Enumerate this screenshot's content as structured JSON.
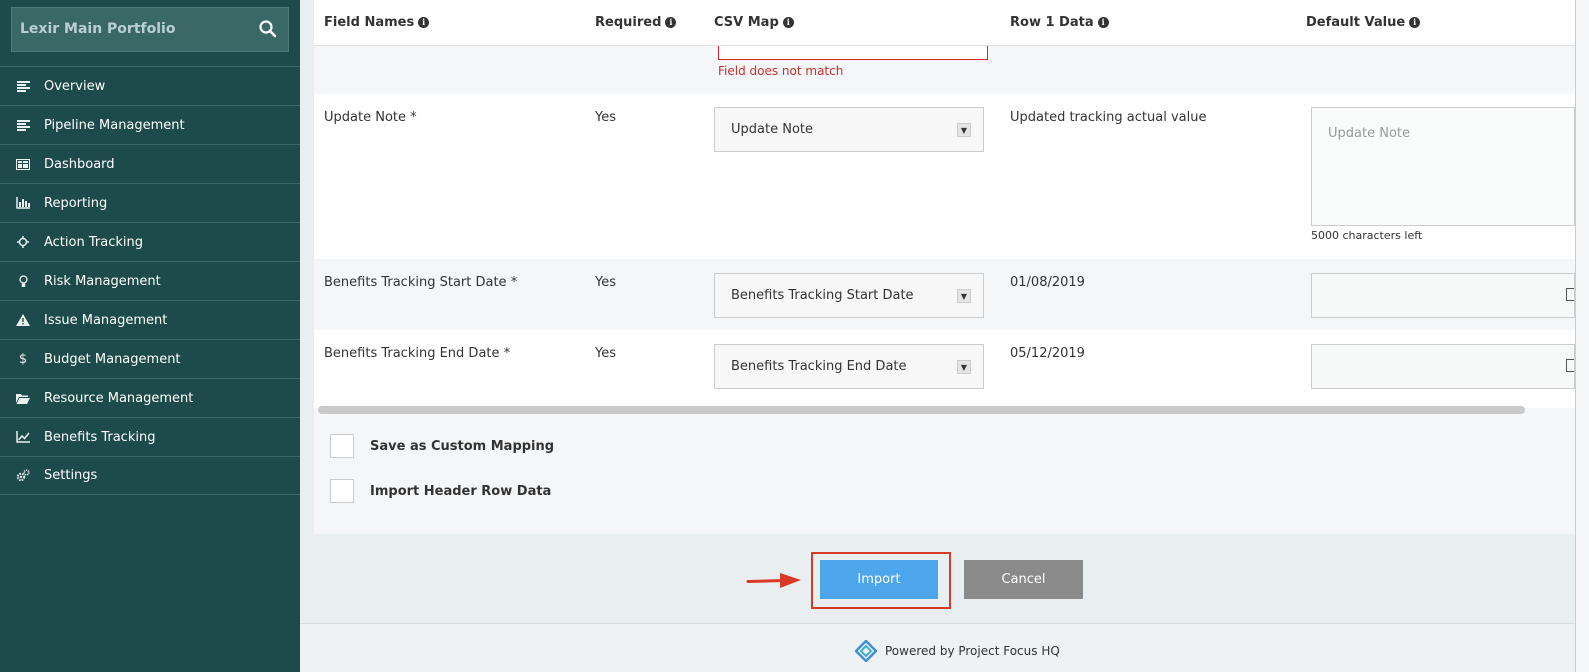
{
  "sidebar": {
    "portfolio_name": "Lexir Main Portfolio",
    "items": [
      {
        "label": "Overview",
        "icon": "list-icon"
      },
      {
        "label": "Pipeline Management",
        "icon": "list-icon"
      },
      {
        "label": "Dashboard",
        "icon": "dashboard-icon"
      },
      {
        "label": "Reporting",
        "icon": "bar-chart-icon"
      },
      {
        "label": "Action Tracking",
        "icon": "crosshair-icon"
      },
      {
        "label": "Risk Management",
        "icon": "lightbulb-icon"
      },
      {
        "label": "Issue Management",
        "icon": "warning-icon"
      },
      {
        "label": "Budget Management",
        "icon": "dollar-icon"
      },
      {
        "label": "Resource Management",
        "icon": "folder-icon"
      },
      {
        "label": "Benefits Tracking",
        "icon": "line-chart-icon"
      },
      {
        "label": "Settings",
        "icon": "gears-icon"
      }
    ]
  },
  "table": {
    "headers": {
      "field_names": "Field Names",
      "required": "Required",
      "csv_map": "CSV Map",
      "row1": "Row 1 Data",
      "default_value": "Default Value"
    },
    "error_text": "Field does not match",
    "rows": [
      {
        "field": "Update Note *",
        "required": "Yes",
        "csv_map": "Update Note",
        "row1": "Updated tracking actual value",
        "default_placeholder": "Update Note",
        "chars_left": "5000 characters left"
      },
      {
        "field": "Benefits Tracking Start Date *",
        "required": "Yes",
        "csv_map": "Benefits Tracking Start Date",
        "row1": "01/08/2019"
      },
      {
        "field": "Benefits Tracking End Date *",
        "required": "Yes",
        "csv_map": "Benefits Tracking End Date",
        "row1": "05/12/2019"
      }
    ]
  },
  "options": {
    "save_custom_mapping": "Save as Custom Mapping",
    "import_header_row": "Import Header Row Data"
  },
  "actions": {
    "import": "Import",
    "cancel": "Cancel"
  },
  "footer": {
    "powered_by": "Powered by Project Focus HQ"
  },
  "colors": {
    "sidebar_bg": "#1d4b4b",
    "import_button": "#4da5ec",
    "cancel_button": "#8a8a8a",
    "error": "#c9302c",
    "highlight": "#d73a26"
  }
}
